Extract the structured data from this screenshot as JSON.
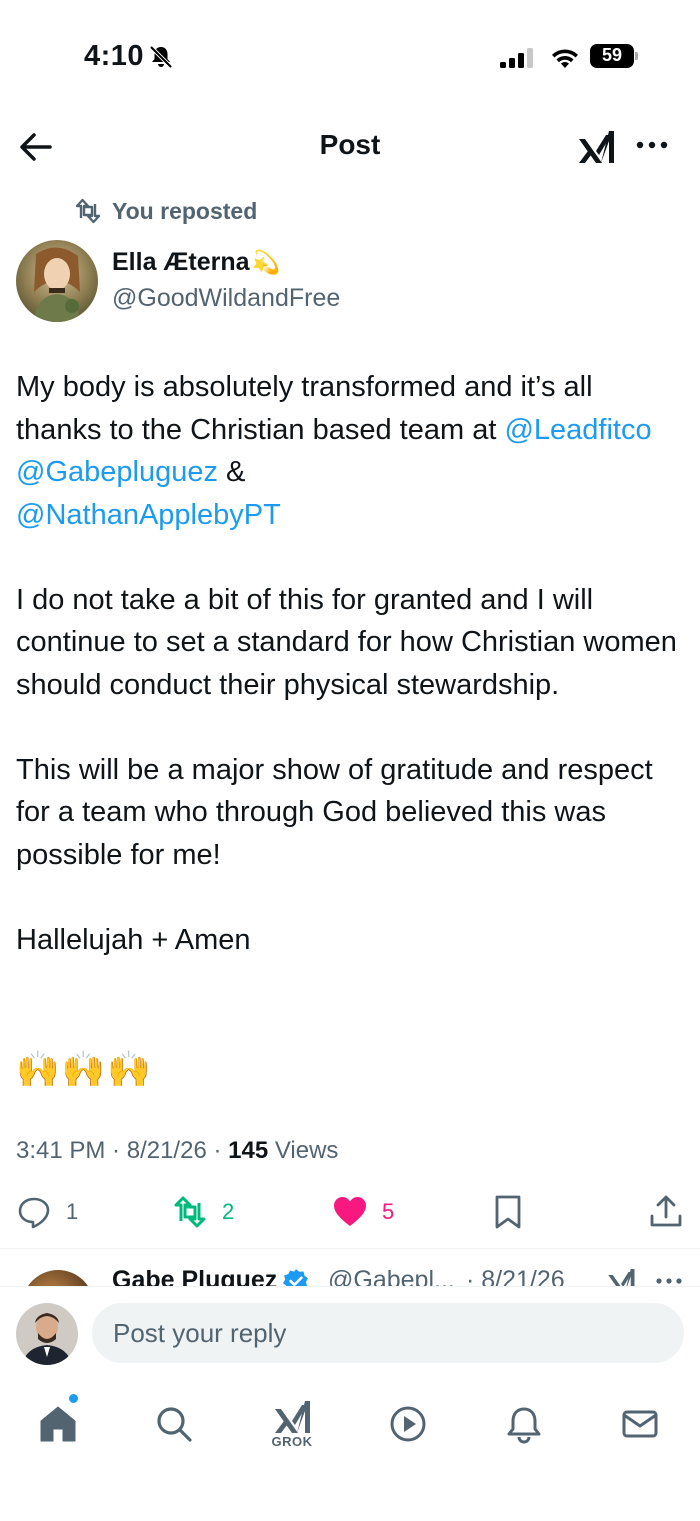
{
  "status_bar": {
    "time": "4:10",
    "battery": "59"
  },
  "nav": {
    "title": "Post"
  },
  "repost": {
    "label": "You reposted"
  },
  "author": {
    "name": "Ella Æterna",
    "badge_emoji": "💫",
    "handle": "@GoodWildandFree"
  },
  "post": {
    "para1_text": "My body is absolutely transformed and it’s all thanks to the Christian based team at",
    "mention1": "@Leadfitco",
    "mention2": "@Gabepluguez",
    "amp": "&",
    "mention3": "@NathanApplebyPT",
    "para2": "I do not take a bit of this for granted and I will continue to set a standard for how Christian women should conduct their physical stewardship.",
    "para3": "This will be a major show of gratitude and respect for a team who through God believed this was possible for me!",
    "para4": "Hallelujah + Amen",
    "emojis": [
      "🙌",
      "🙌",
      "🙌"
    ]
  },
  "meta": {
    "time": "3:41 PM",
    "date": "8/21/26",
    "views_count": "145",
    "views_label": "Views"
  },
  "actions": {
    "replies": "1",
    "reposts": "2",
    "likes": "5",
    "colors": {
      "repost": "#00ba7c",
      "like": "#f91880",
      "icon": "#536471"
    }
  },
  "reply_peek": {
    "name": "Gabe Pluguez",
    "handle": "@Gabepl...",
    "date": "· 8/21/26"
  },
  "reply_bar": {
    "placeholder": "Post your reply"
  },
  "tabs": {
    "grok_label": "GROK"
  },
  "colors": {
    "accent": "#1d9bf0",
    "text": "#0f1419",
    "secondary": "#536471"
  }
}
